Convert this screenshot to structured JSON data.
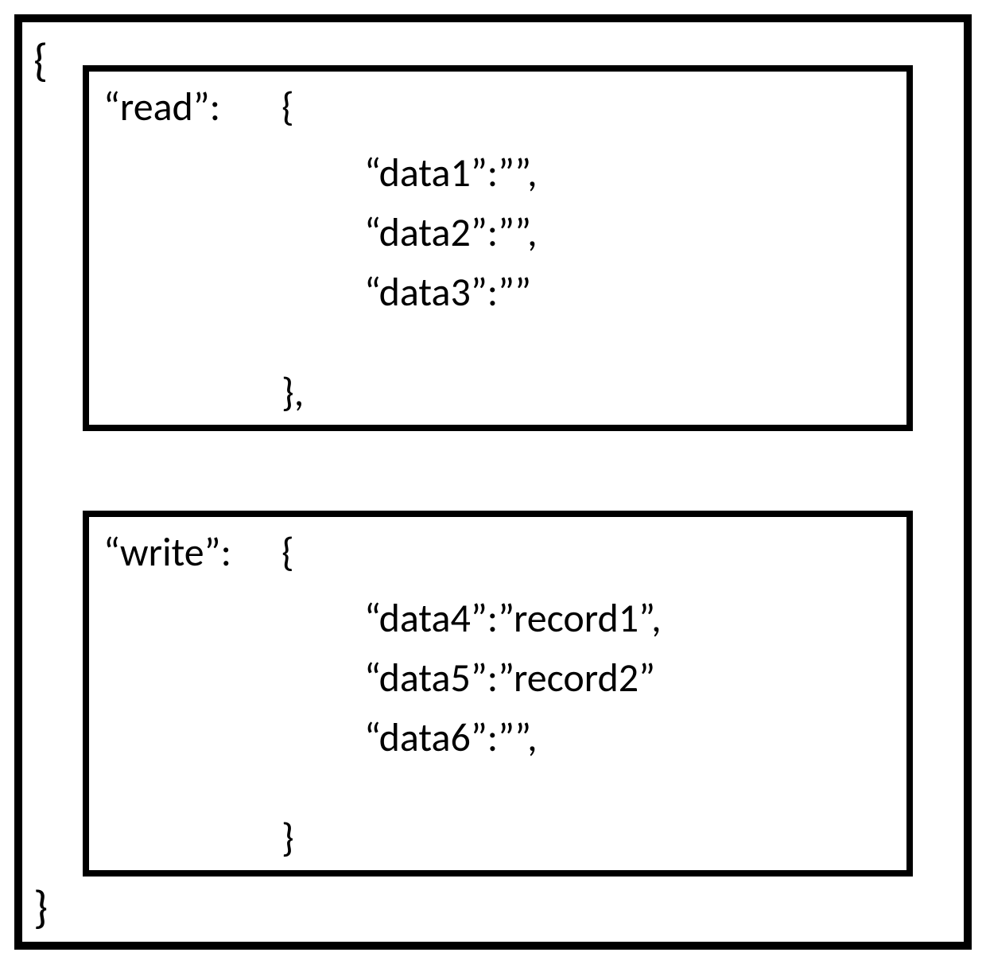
{
  "outer": {
    "open_brace": "{",
    "close_brace": "}"
  },
  "read_block": {
    "key": "“read”:",
    "open_brace": "{",
    "close_brace": "},",
    "entries": [
      "“data1”:””,",
      "“data2”:””,",
      "“data3”:””"
    ]
  },
  "write_block": {
    "key": "“write”:",
    "open_brace": "{",
    "close_brace": "}",
    "entries": [
      "“data4”:”record1”,",
      "“data5”:”record2”",
      "“data6”:””,"
    ]
  }
}
